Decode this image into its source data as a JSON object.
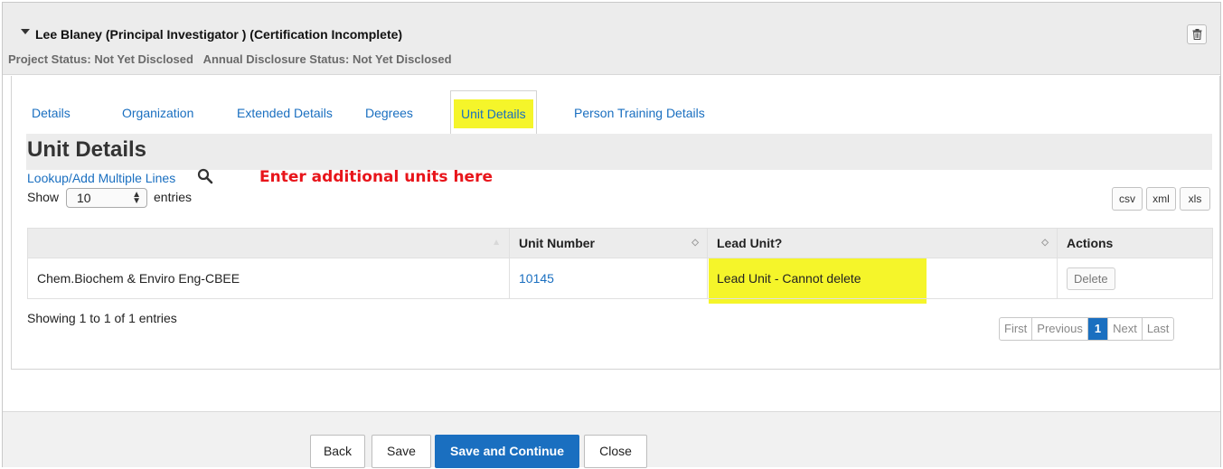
{
  "person": {
    "title": "Lee Blaney (Principal Investigator ) (Certification Incomplete)",
    "project_status": "Project Status: Not Yet Disclosed",
    "annual_status": "Annual Disclosure Status: Not Yet Disclosed",
    "delete_icon": "trash-icon"
  },
  "tabs": [
    {
      "label": "Details",
      "active": false
    },
    {
      "label": "Organization",
      "active": false
    },
    {
      "label": "Extended Details",
      "active": false
    },
    {
      "label": "Degrees",
      "active": false
    },
    {
      "label": "Unit Details",
      "active": true
    },
    {
      "label": "Person Training Details",
      "active": false
    }
  ],
  "section": {
    "title": "Unit Details",
    "lookup_link": "Lookup/Add Multiple Lines",
    "lookup_icon": "magnifier-icon",
    "annotation": "Enter additional units here"
  },
  "entries": {
    "show_label": "Show",
    "selected": "10",
    "entries_label": "entries"
  },
  "export": {
    "csv": "csv",
    "xml": "xml",
    "xls": "xls"
  },
  "table": {
    "headers": [
      "",
      "Unit Number",
      "Lead Unit?",
      "Actions"
    ],
    "rows": [
      {
        "unit_name": "Chem.Biochem & Enviro Eng-CBEE",
        "unit_number": "10145",
        "lead_unit": "Lead Unit - Cannot delete",
        "action": "Delete"
      }
    ]
  },
  "pagination": {
    "summary": "Showing 1 to 1 of 1 entries",
    "first": "First",
    "previous": "Previous",
    "current": "1",
    "next": "Next",
    "last": "Last"
  },
  "footer": {
    "back": "Back",
    "save": "Save",
    "save_continue": "Save and Continue",
    "close": "Close"
  },
  "colors": {
    "link": "#1a6fc0",
    "highlight": "#f5f52a",
    "annotation": "#e8151b",
    "primary_button": "#1a6fc0"
  }
}
